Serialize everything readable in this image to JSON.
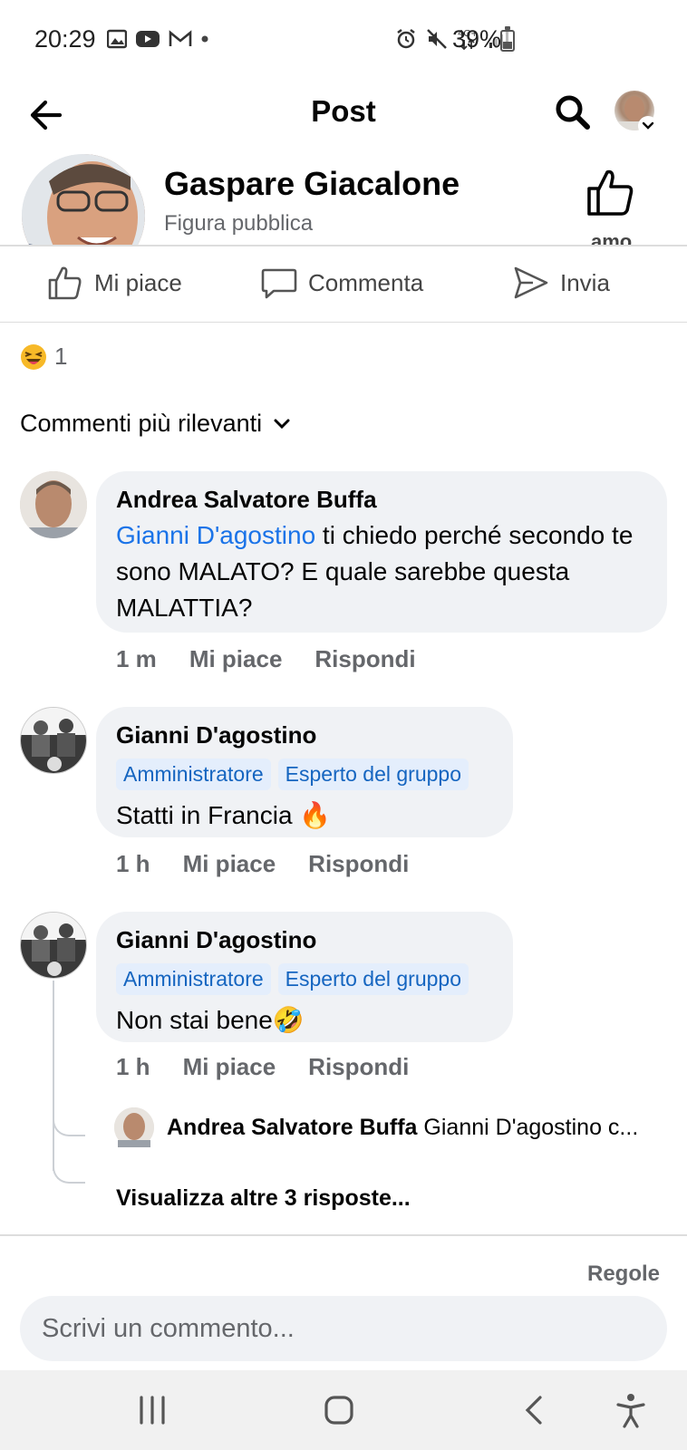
{
  "status_bar": {
    "time": "20:29",
    "battery": "39%",
    "battery_level": 0.39,
    "network": "4G+"
  },
  "header": {
    "title": "Post"
  },
  "page": {
    "name": "Gaspare Giacalone",
    "subtitle": "Figura pubblica",
    "like_label": "amo"
  },
  "actions": {
    "like": "Mi piace",
    "comment": "Commenta",
    "send": "Invia"
  },
  "reactions": {
    "count": "1"
  },
  "sort": {
    "label": "Commenti più rilevanti"
  },
  "comments": [
    {
      "author": "Andrea Salvatore Buffa",
      "mention": "Gianni D'agostino",
      "text": " ti chiedo perché secondo te sono MALATO? E quale sarebbe questa MALATTIA?",
      "time": "1 m",
      "like": "Mi piace",
      "reply": "Rispondi"
    },
    {
      "author": "Gianni D'agostino",
      "badges": [
        "Amministratore",
        "Esperto del gruppo"
      ],
      "text": "Statti in Francia 🔥",
      "time": "1 h",
      "like": "Mi piace",
      "reply": "Rispondi"
    },
    {
      "author": "Gianni D'agostino",
      "badges": [
        "Amministratore",
        "Esperto del gruppo"
      ],
      "text": "Non stai bene🤣",
      "time": "1 h",
      "like": "Mi piace",
      "reply": "Rispondi"
    }
  ],
  "reply_preview": {
    "author": "Andrea Salvatore Buffa",
    "snippet": "Gianni D'agostino c..."
  },
  "more_replies": "Visualizza altre 3 risposte...",
  "composer": {
    "rules": "Regole",
    "placeholder": "Scrivi un commento..."
  },
  "colors": {
    "link": "#1a73e8",
    "bubble": "#f0f2f5",
    "badge_bg": "#e4eefc",
    "badge_text": "#1565c0"
  }
}
